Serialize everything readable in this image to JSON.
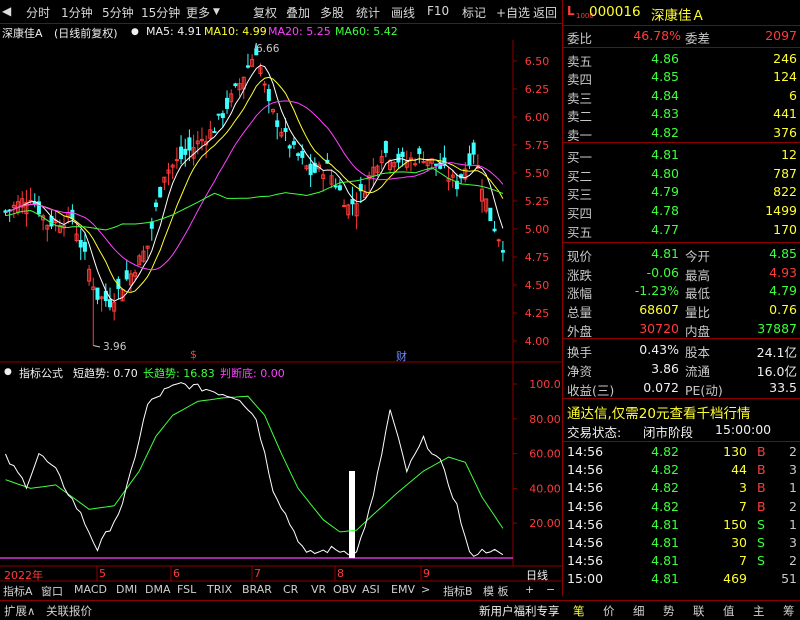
{
  "toolbar": {
    "left": [
      "分时",
      "1分钟",
      "5分钟",
      "15分钟",
      "更多"
    ],
    "right": [
      "复权",
      "叠加",
      "多股",
      "统计",
      "画线",
      "F10",
      "标记",
      "+自选",
      "返回"
    ]
  },
  "chart_header": {
    "name": "深康佳A",
    "mode": "(日线前复权)",
    "ma5": "MA5: 4.91",
    "ma10": "MA10: 4.99",
    "ma20": "MA20: 5.25",
    "ma60": "MA60: 5.42"
  },
  "price_axis": [
    "6.50",
    "6.25",
    "6.00",
    "5.75",
    "5.50",
    "5.25",
    "5.00",
    "4.75",
    "4.50",
    "4.25",
    "4.00"
  ],
  "annotations": {
    "high": "6.66",
    "low": "3.96",
    "marker1": "$",
    "marker2": "财"
  },
  "indicator_header": {
    "name": "指标公式",
    "short": "短趋势: 0.70",
    "long": "长趋势: 16.83",
    "bottom": "判断底: 0.00"
  },
  "indicator_axis": [
    "100.0",
    "80.00",
    "60.00",
    "40.00",
    "20.00"
  ],
  "time_axis": [
    "2022年",
    "5",
    "6",
    "7",
    "8",
    "9"
  ],
  "time_axis_right": "日线",
  "bottom_tabs": [
    "指标A",
    "窗口",
    "MACD",
    "DMI",
    "DMA",
    "FSL",
    "TRIX",
    "BRAR",
    "CR",
    "VR",
    "OBV",
    "ASI",
    "EMV",
    ">",
    "指标B",
    "模 板",
    "+",
    "−"
  ],
  "status": {
    "left": [
      "扩展∧",
      "关联报价"
    ],
    "promo": "新用户福利专享",
    "tabs": [
      "笔",
      "价",
      "细",
      "势",
      "联",
      "值",
      "主",
      "筹"
    ]
  },
  "quote": {
    "code": "000016",
    "name": "深康佳Ａ",
    "weibi_label": "委比",
    "weibi": "46.78%",
    "weicha_label": "委差",
    "weicha": "2097",
    "asks": [
      {
        "label": "卖五",
        "price": "4.86",
        "vol": "246"
      },
      {
        "label": "卖四",
        "price": "4.85",
        "vol": "124"
      },
      {
        "label": "卖三",
        "price": "4.84",
        "vol": "6"
      },
      {
        "label": "卖二",
        "price": "4.83",
        "vol": "441"
      },
      {
        "label": "卖一",
        "price": "4.82",
        "vol": "376"
      }
    ],
    "bids": [
      {
        "label": "买一",
        "price": "4.81",
        "vol": "12"
      },
      {
        "label": "买二",
        "price": "4.80",
        "vol": "787"
      },
      {
        "label": "买三",
        "price": "4.79",
        "vol": "822"
      },
      {
        "label": "买四",
        "price": "4.78",
        "vol": "1499"
      },
      {
        "label": "买五",
        "price": "4.77",
        "vol": "170"
      }
    ],
    "stats1": [
      {
        "l1": "现价",
        "v1": "4.81",
        "c1": "green",
        "l2": "今开",
        "v2": "4.85",
        "c2": "green"
      },
      {
        "l1": "涨跌",
        "v1": "-0.06",
        "c1": "green",
        "l2": "最高",
        "v2": "4.93",
        "c2": "red"
      },
      {
        "l1": "涨幅",
        "v1": "-1.23%",
        "c1": "green",
        "l2": "最低",
        "v2": "4.79",
        "c2": "green"
      },
      {
        "l1": "总量",
        "v1": "68607",
        "c1": "yellow",
        "l2": "量比",
        "v2": "0.76",
        "c2": "yellow"
      },
      {
        "l1": "外盘",
        "v1": "30720",
        "c1": "red",
        "l2": "内盘",
        "v2": "37887",
        "c2": "green"
      }
    ],
    "stats2": [
      {
        "l1": "换手",
        "v1": "0.43%",
        "l2": "股本",
        "v2": "24.1亿"
      },
      {
        "l1": "净资",
        "v1": "3.86",
        "l2": "流通",
        "v2": "16.0亿"
      },
      {
        "l1": "收益(三)",
        "v1": "0.072",
        "l2": "PE(动)",
        "v2": "33.5"
      }
    ],
    "ad": "通达信,仅需20元查看千档行情",
    "trade_status_label": "交易状态:",
    "trade_status": "闭市阶段",
    "trade_time": "15:00:00",
    "ticks": [
      {
        "t": "14:56",
        "p": "4.82",
        "v": "130",
        "d": "B",
        "n": "2"
      },
      {
        "t": "14:56",
        "p": "4.82",
        "v": "44",
        "d": "B",
        "n": "3"
      },
      {
        "t": "14:56",
        "p": "4.82",
        "v": "3",
        "d": "B",
        "n": "1"
      },
      {
        "t": "14:56",
        "p": "4.82",
        "v": "7",
        "d": "B",
        "n": "2"
      },
      {
        "t": "14:56",
        "p": "4.81",
        "v": "150",
        "d": "S",
        "n": "1"
      },
      {
        "t": "14:56",
        "p": "4.81",
        "v": "30",
        "d": "S",
        "n": "3"
      },
      {
        "t": "14:56",
        "p": "4.81",
        "v": "7",
        "d": "S",
        "n": "2"
      },
      {
        "t": "15:00",
        "p": "4.81",
        "v": "469",
        "d": "",
        "n": "51"
      }
    ]
  },
  "colors": {
    "up": "#ff3b3b",
    "down": "#3cffff",
    "ma5": "#ffffff",
    "ma10": "#ffff30",
    "ma20": "#ff40ff",
    "ma60": "#40ff40",
    "axis": "#8b0000"
  }
}
